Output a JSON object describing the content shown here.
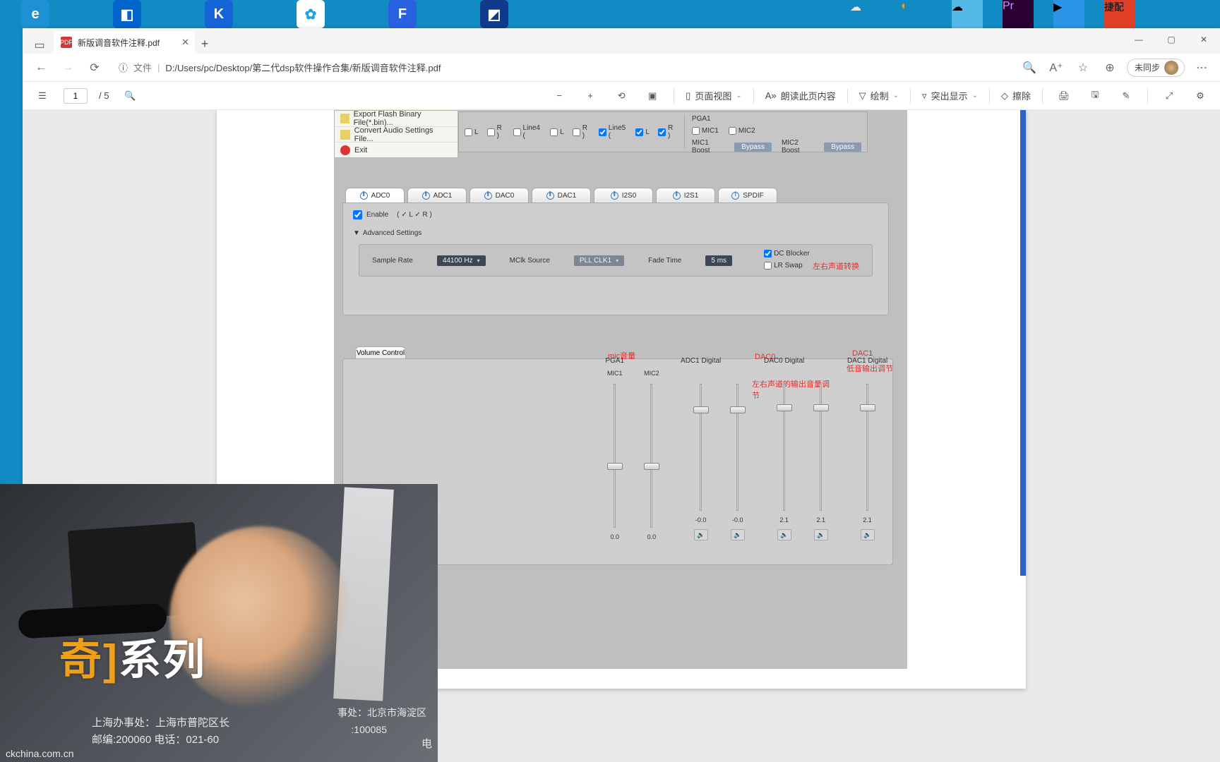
{
  "browser": {
    "tab_title": "新版调音软件注释.pdf",
    "file_label": "文件",
    "url": "D:/Users/pc/Desktop/第二代dsp软件操作合集/新版调音软件注释.pdf",
    "profile": "未同步"
  },
  "pdfbar": {
    "page_current": "1",
    "page_sep": "/ 5",
    "page_view": "页面视图",
    "read_aloud": "朗读此页内容",
    "draw": "绘制",
    "highlight": "突出显示",
    "erase": "擦除"
  },
  "menu": {
    "export": "Export Flash Binary File(*.bin)...",
    "convert": "Convert Audio Settings File...",
    "exit": "Exit"
  },
  "top": {
    "r1": "R )",
    "line4": "Line4 (",
    "l": "L",
    "r": "R )",
    "line5": "Line5 (",
    "l5": "L",
    "r5": "R )",
    "pga1": "PGA1",
    "mic1": "MIC1",
    "mic2": "MIC2",
    "mic1boost": "MIC1 Boost",
    "mic2boost": "MIC2 Boost",
    "bypass": "Bypass"
  },
  "tabs": {
    "adc0": "ADC0",
    "adc1": "ADC1",
    "dac0": "DAC0",
    "dac1": "DAC1",
    "i2s0": "I2S0",
    "i2s1": "I2S1",
    "spdif": "SPDIF"
  },
  "body": {
    "enable": "Enable",
    "enable_suffix": "(  ✓ L   ✓ R )",
    "adv": "Advanced Settings",
    "sample_rate_l": "Sample Rate",
    "sample_rate_v": "44100 Hz",
    "mclk_l": "MClk Source",
    "mclk_v": "PLL CLK1",
    "fade_l": "Fade Time",
    "fade_v": "5 ms",
    "dc": "DC Blocker",
    "lrswap": "LR Swap",
    "lrswap_note": "左右声道转换"
  },
  "vol": {
    "tab": "Volume Control"
  },
  "notes": {
    "mic": "mic音量",
    "dac0": "DAC0",
    "dac1": "DAC1",
    "lr_out": "左右声道的输出音量调节",
    "bass": "低音输出调节"
  },
  "mixer": {
    "pga1": "PGA1",
    "adc1d": "ADC1 Digital",
    "dac0d": "DAC0 Digital",
    "dac1d": "DAC1 Digital",
    "mic1": "MIC1",
    "mic2": "MIC2",
    "v00": "0.0",
    "vn00": "-0.0",
    "v21": "2.1"
  },
  "photo": {
    "logo_a": "奇]",
    "logo_b": "系列",
    "addr1": "上海办事处：上海市普陀区长",
    "addr2": "邮编:200060    电话：021-60",
    "site": "ckchina.com.cn",
    "addr3": "事处：北京市海淀区",
    "addr4": ":100085",
    "dian": "电"
  }
}
